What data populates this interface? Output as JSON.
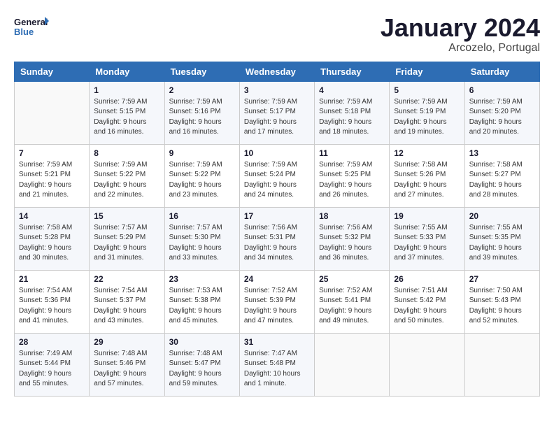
{
  "header": {
    "logo_general": "General",
    "logo_blue": "Blue",
    "title": "January 2024",
    "location": "Arcozelo, Portugal"
  },
  "days_of_week": [
    "Sunday",
    "Monday",
    "Tuesday",
    "Wednesday",
    "Thursday",
    "Friday",
    "Saturday"
  ],
  "weeks": [
    [
      {
        "day": "",
        "info": ""
      },
      {
        "day": "1",
        "info": "Sunrise: 7:59 AM\nSunset: 5:15 PM\nDaylight: 9 hours\nand 16 minutes."
      },
      {
        "day": "2",
        "info": "Sunrise: 7:59 AM\nSunset: 5:16 PM\nDaylight: 9 hours\nand 16 minutes."
      },
      {
        "day": "3",
        "info": "Sunrise: 7:59 AM\nSunset: 5:17 PM\nDaylight: 9 hours\nand 17 minutes."
      },
      {
        "day": "4",
        "info": "Sunrise: 7:59 AM\nSunset: 5:18 PM\nDaylight: 9 hours\nand 18 minutes."
      },
      {
        "day": "5",
        "info": "Sunrise: 7:59 AM\nSunset: 5:19 PM\nDaylight: 9 hours\nand 19 minutes."
      },
      {
        "day": "6",
        "info": "Sunrise: 7:59 AM\nSunset: 5:20 PM\nDaylight: 9 hours\nand 20 minutes."
      }
    ],
    [
      {
        "day": "7",
        "info": "Sunrise: 7:59 AM\nSunset: 5:21 PM\nDaylight: 9 hours\nand 21 minutes."
      },
      {
        "day": "8",
        "info": "Sunrise: 7:59 AM\nSunset: 5:22 PM\nDaylight: 9 hours\nand 22 minutes."
      },
      {
        "day": "9",
        "info": "Sunrise: 7:59 AM\nSunset: 5:22 PM\nDaylight: 9 hours\nand 23 minutes."
      },
      {
        "day": "10",
        "info": "Sunrise: 7:59 AM\nSunset: 5:24 PM\nDaylight: 9 hours\nand 24 minutes."
      },
      {
        "day": "11",
        "info": "Sunrise: 7:59 AM\nSunset: 5:25 PM\nDaylight: 9 hours\nand 26 minutes."
      },
      {
        "day": "12",
        "info": "Sunrise: 7:58 AM\nSunset: 5:26 PM\nDaylight: 9 hours\nand 27 minutes."
      },
      {
        "day": "13",
        "info": "Sunrise: 7:58 AM\nSunset: 5:27 PM\nDaylight: 9 hours\nand 28 minutes."
      }
    ],
    [
      {
        "day": "14",
        "info": "Sunrise: 7:58 AM\nSunset: 5:28 PM\nDaylight: 9 hours\nand 30 minutes."
      },
      {
        "day": "15",
        "info": "Sunrise: 7:57 AM\nSunset: 5:29 PM\nDaylight: 9 hours\nand 31 minutes."
      },
      {
        "day": "16",
        "info": "Sunrise: 7:57 AM\nSunset: 5:30 PM\nDaylight: 9 hours\nand 33 minutes."
      },
      {
        "day": "17",
        "info": "Sunrise: 7:56 AM\nSunset: 5:31 PM\nDaylight: 9 hours\nand 34 minutes."
      },
      {
        "day": "18",
        "info": "Sunrise: 7:56 AM\nSunset: 5:32 PM\nDaylight: 9 hours\nand 36 minutes."
      },
      {
        "day": "19",
        "info": "Sunrise: 7:55 AM\nSunset: 5:33 PM\nDaylight: 9 hours\nand 37 minutes."
      },
      {
        "day": "20",
        "info": "Sunrise: 7:55 AM\nSunset: 5:35 PM\nDaylight: 9 hours\nand 39 minutes."
      }
    ],
    [
      {
        "day": "21",
        "info": "Sunrise: 7:54 AM\nSunset: 5:36 PM\nDaylight: 9 hours\nand 41 minutes."
      },
      {
        "day": "22",
        "info": "Sunrise: 7:54 AM\nSunset: 5:37 PM\nDaylight: 9 hours\nand 43 minutes."
      },
      {
        "day": "23",
        "info": "Sunrise: 7:53 AM\nSunset: 5:38 PM\nDaylight: 9 hours\nand 45 minutes."
      },
      {
        "day": "24",
        "info": "Sunrise: 7:52 AM\nSunset: 5:39 PM\nDaylight: 9 hours\nand 47 minutes."
      },
      {
        "day": "25",
        "info": "Sunrise: 7:52 AM\nSunset: 5:41 PM\nDaylight: 9 hours\nand 49 minutes."
      },
      {
        "day": "26",
        "info": "Sunrise: 7:51 AM\nSunset: 5:42 PM\nDaylight: 9 hours\nand 50 minutes."
      },
      {
        "day": "27",
        "info": "Sunrise: 7:50 AM\nSunset: 5:43 PM\nDaylight: 9 hours\nand 52 minutes."
      }
    ],
    [
      {
        "day": "28",
        "info": "Sunrise: 7:49 AM\nSunset: 5:44 PM\nDaylight: 9 hours\nand 55 minutes."
      },
      {
        "day": "29",
        "info": "Sunrise: 7:48 AM\nSunset: 5:46 PM\nDaylight: 9 hours\nand 57 minutes."
      },
      {
        "day": "30",
        "info": "Sunrise: 7:48 AM\nSunset: 5:47 PM\nDaylight: 9 hours\nand 59 minutes."
      },
      {
        "day": "31",
        "info": "Sunrise: 7:47 AM\nSunset: 5:48 PM\nDaylight: 10 hours\nand 1 minute."
      },
      {
        "day": "",
        "info": ""
      },
      {
        "day": "",
        "info": ""
      },
      {
        "day": "",
        "info": ""
      }
    ]
  ]
}
